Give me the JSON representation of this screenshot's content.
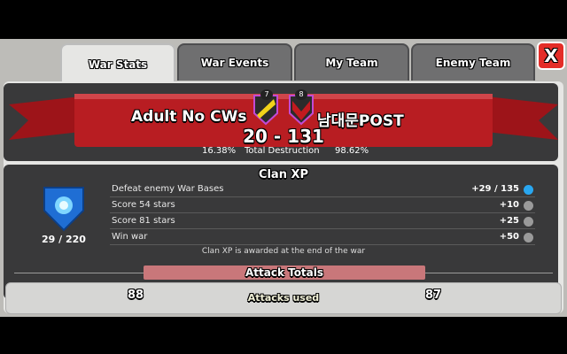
{
  "tabs": [
    {
      "label": "War Stats",
      "active": true
    },
    {
      "label": "War Events",
      "active": false
    },
    {
      "label": "My Team",
      "active": false
    },
    {
      "label": "Enemy Team",
      "active": false
    }
  ],
  "close_label": "X",
  "home_team": {
    "name": "Adult No CWs",
    "level": "7"
  },
  "away_team": {
    "name": "남대문POST",
    "level": "8"
  },
  "score": "20 - 131",
  "destruction": {
    "home": "16.38%",
    "label": "Total Destruction",
    "away": "98.62%"
  },
  "clan_xp": {
    "title": "Clan XP",
    "progress": "29 / 220",
    "rows": [
      {
        "label": "Defeat enemy War Bases",
        "value": "+29 / 135"
      },
      {
        "label": "Score 54 stars",
        "value": "+10"
      },
      {
        "label": "Score 81 stars",
        "value": "+25"
      },
      {
        "label": "Win war",
        "value": "+50"
      }
    ],
    "footnote": "Clan XP is awarded at the end of the war"
  },
  "attack_totals": {
    "title": "Attack Totals",
    "home": "88",
    "label": "Attacks used",
    "away": "87"
  },
  "colors": {
    "ribbon": "#b81d22",
    "tab_active": "#e6e6e4",
    "close": "#e42d28",
    "xp_gem": "#29a7f0"
  }
}
